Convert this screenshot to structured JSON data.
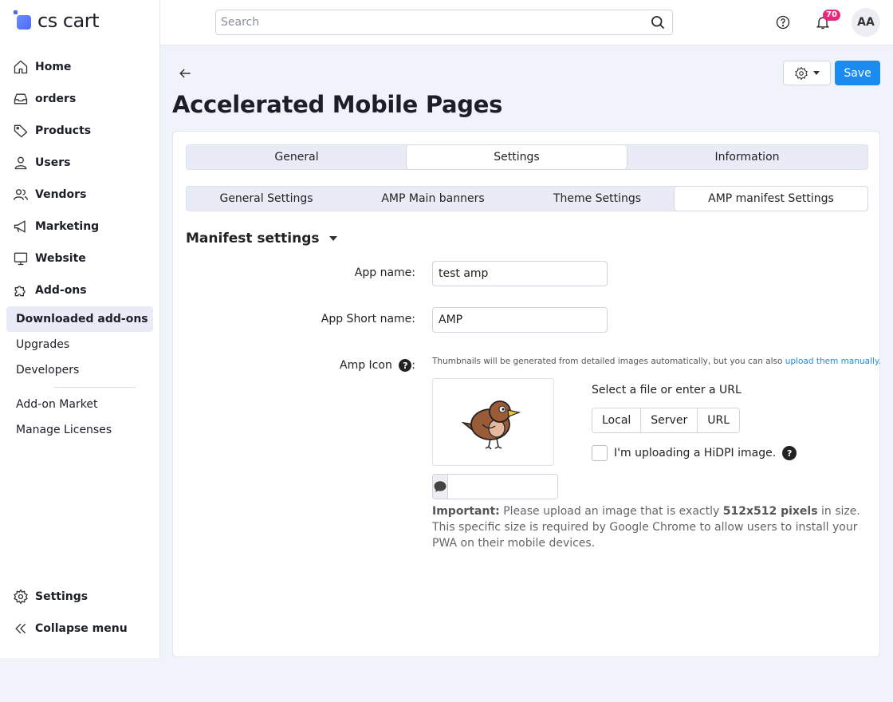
{
  "brand": {
    "name": "cs cart"
  },
  "sidebar": {
    "items": [
      {
        "label": "Home",
        "icon": "home-icon"
      },
      {
        "label": "orders",
        "icon": "inbox-icon"
      },
      {
        "label": "Products",
        "icon": "tag-icon"
      },
      {
        "label": "Users",
        "icon": "user-icon"
      },
      {
        "label": "Vendors",
        "icon": "users-icon"
      },
      {
        "label": "Marketing",
        "icon": "megaphone-icon"
      },
      {
        "label": "Website",
        "icon": "monitor-icon"
      },
      {
        "label": "Add-ons",
        "icon": "puzzle-icon"
      }
    ],
    "subitems": [
      {
        "label": "Downloaded add-ons",
        "active": true
      },
      {
        "label": "Upgrades"
      },
      {
        "label": "Developers"
      },
      {
        "label": "Add-on Market"
      },
      {
        "label": "Manage Licenses"
      }
    ],
    "bottom": {
      "settings": "Settings",
      "collapse": "Collapse menu"
    }
  },
  "topbar": {
    "search_placeholder": "Search",
    "notifications_count": "70",
    "avatar_initials": "AA"
  },
  "page": {
    "title": "Accelerated Mobile Pages",
    "save_label": "Save"
  },
  "tabs": [
    {
      "label": "General"
    },
    {
      "label": "Settings",
      "active": true
    },
    {
      "label": "Information"
    }
  ],
  "subtabs": [
    {
      "label": "General Settings"
    },
    {
      "label": "AMP Main banners"
    },
    {
      "label": "Theme Settings"
    },
    {
      "label": "AMP manifest Settings",
      "active": true
    }
  ],
  "manifest": {
    "section_title": "Manifest settings",
    "app_name_label": "App name:",
    "app_name_value": "test amp",
    "short_name_label": "App Short name:",
    "short_name_value": "AMP",
    "icon_label": "Amp Icon",
    "icon_colon": ":",
    "help_glyph": "?",
    "thumb_note": "Thumbnails will be generated from detailed images automatically, but you can also ",
    "thumb_link": "upload them manually.",
    "select_file_label": "Select a file or enter a URL",
    "source_local": "Local",
    "source_server": "Server",
    "source_url": "URL",
    "hidpi_label": "I'm uploading a HiDPI image.",
    "alt_text_value": "",
    "important_strong": "Important:",
    "important_text_1": " Please upload an image that is exactly ",
    "important_size": "512x512 pixels",
    "important_text_2": " in size. This specific size is required by Google Chrome to allow users to install your PWA on their mobile devices."
  },
  "colors": {
    "accent": "#1a8cf0",
    "badge": "#e8287b",
    "background": "#f1f3fb"
  }
}
